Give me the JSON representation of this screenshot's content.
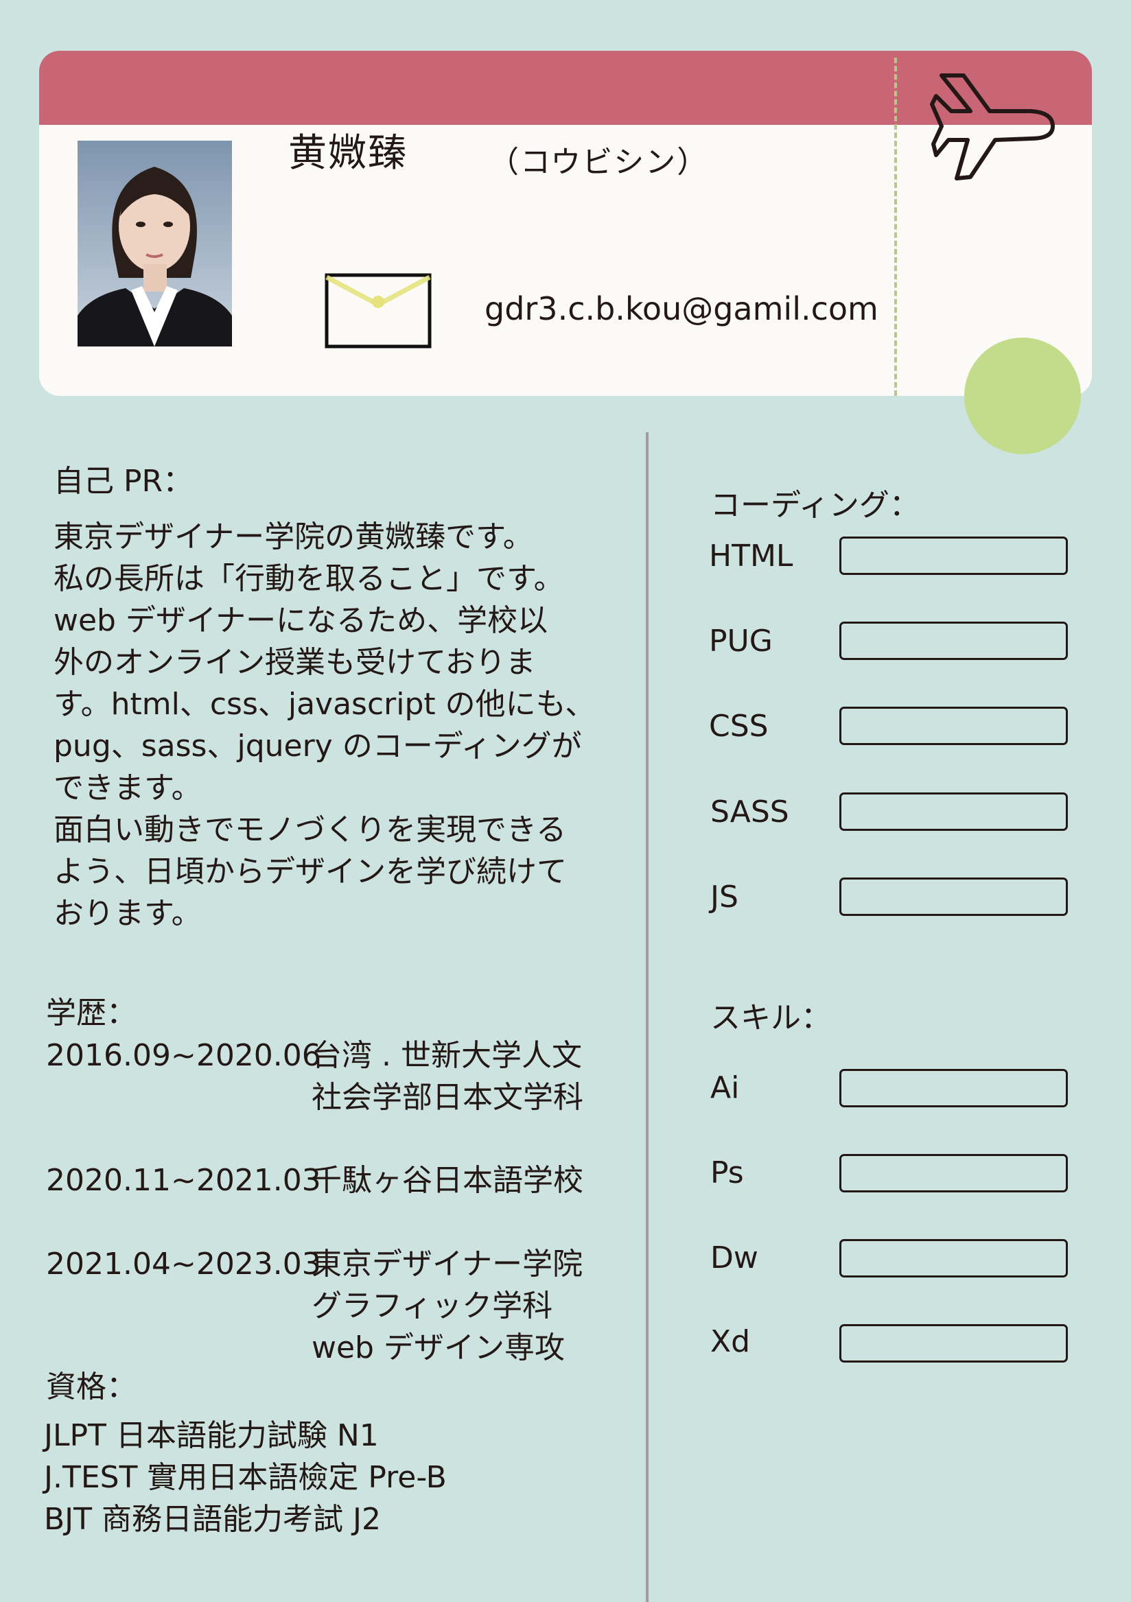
{
  "header": {
    "name": "黄媺臻",
    "name_kana": "（コウビシン）",
    "email": "gdr3.c.b.kou@gamil.com"
  },
  "colors": {
    "background": "#cde3e0",
    "ticket": "#fbfaf6",
    "band": "#c86676",
    "accent_green": "#c3dc8c"
  },
  "icons": [
    "portrait-photo",
    "envelope-icon",
    "airplane-icon"
  ],
  "pr": {
    "heading": "自己 PR：",
    "lines": [
      "東京デザイナー学院の黄媺臻です。",
      "私の長所は「行動を取ること」です。",
      "web デザイナーになるため、学校以",
      "外のオンライン授業も受けておりま",
      "す。html、css、javascript の他にも、",
      "pug、sass、jquery のコーディングが",
      "できます。",
      "面白い動きでモノづくりを実現できる",
      "よう、日頃からデザインを学び続けて",
      "おります。"
    ]
  },
  "education": {
    "heading": "学歴：",
    "entries": [
      {
        "period": "2016.09~2020.06",
        "lines": [
          "台湾 . 世新大学人文",
          "社会学部日本文学科"
        ]
      },
      {
        "period": "2020.11~2021.03",
        "lines": [
          "千駄ヶ谷日本語学校"
        ]
      },
      {
        "period": "2021.04~2023.03",
        "lines": [
          "東京デザイナー学院",
          "グラフィック学科",
          "web デザイン専攻"
        ]
      }
    ]
  },
  "certifications": {
    "heading": "資格：",
    "items": [
      "JLPT 日本語能力試験 N1",
      "J.TEST 實用日本語檢定 Pre-B",
      "BJT 商務日語能力考試 J2"
    ]
  },
  "coding": {
    "heading": "コーディング：",
    "items": [
      "HTML",
      "PUG",
      "CSS",
      "SASS",
      "JS"
    ]
  },
  "skills": {
    "heading": "スキル：",
    "items": [
      "Ai",
      "Ps",
      "Dw",
      "Xd"
    ]
  }
}
